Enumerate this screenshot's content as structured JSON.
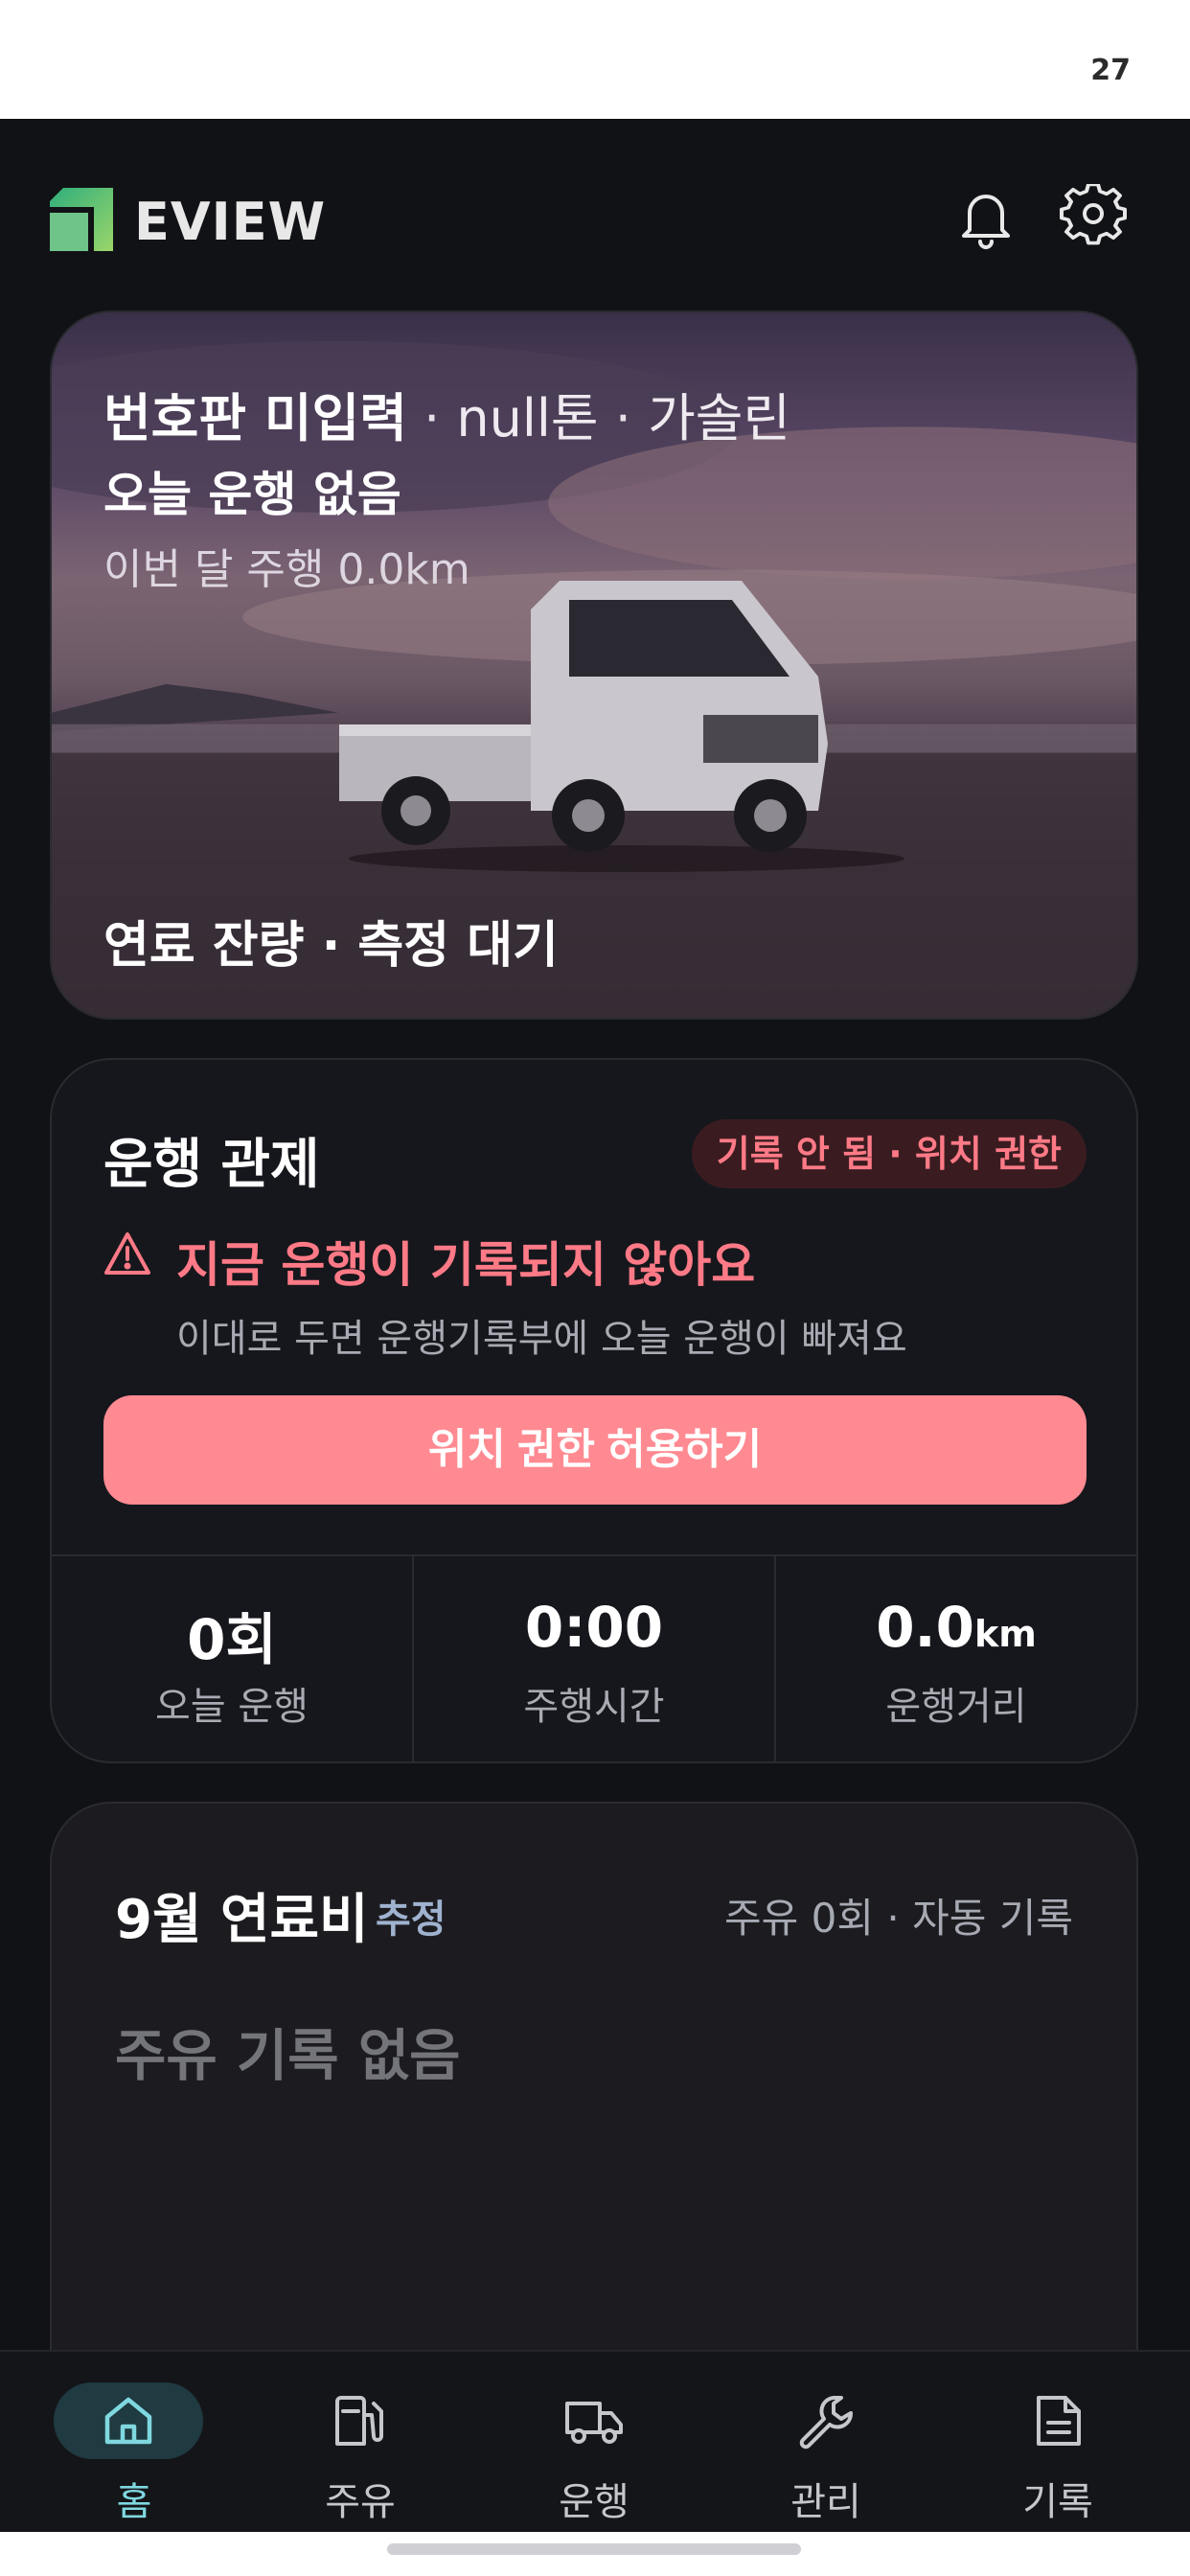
{
  "status_bar": {
    "time": "27"
  },
  "header": {
    "brand": "EVIEW",
    "icons": [
      "bell-icon",
      "gear-icon"
    ]
  },
  "hero": {
    "plate": "번호판 미입력",
    "separator": "·",
    "tonnage": "null톤",
    "fuel_type": "가솔린",
    "today_status": "오늘 운행 없음",
    "month_distance": "이번 달 주행 0.0km",
    "fuel_level": "연료 잔량 · 측정 대기"
  },
  "drive_control": {
    "title": "운행 관제",
    "badge": "기록 안 됨 · 위치 권한",
    "warning_title": "지금 운행이 기록되지 않아요",
    "warning_subtitle": "이대로 두면 운행기록부에 오늘 운행이 빠져요",
    "allow_button": "위치 권한 허용하기",
    "stats": [
      {
        "value": "0회",
        "unit": "",
        "label": "오늘 운행"
      },
      {
        "value": "0:00",
        "unit": "",
        "label": "주행시간"
      },
      {
        "value": "0.0",
        "unit": "km",
        "label": "운행거리"
      }
    ]
  },
  "fuel_cost": {
    "title": "9월 연료비",
    "tag": "추정",
    "summary": "주유 0회 · 자동 기록",
    "empty_text": "주유 기록 없음"
  },
  "bottom_nav": {
    "items": [
      {
        "label": "홈",
        "icon": "home-icon",
        "active": true
      },
      {
        "label": "주유",
        "icon": "fuel-pump-icon",
        "active": false
      },
      {
        "label": "운행",
        "icon": "truck-icon",
        "active": false
      },
      {
        "label": "관리",
        "icon": "wrench-icon",
        "active": false
      },
      {
        "label": "기록",
        "icon": "document-icon",
        "active": false
      }
    ]
  },
  "colors": {
    "background": "#111216",
    "accent_red": "#ff7a86",
    "button_red": "#ff8a92",
    "nav_active": "#7fd8e0"
  }
}
